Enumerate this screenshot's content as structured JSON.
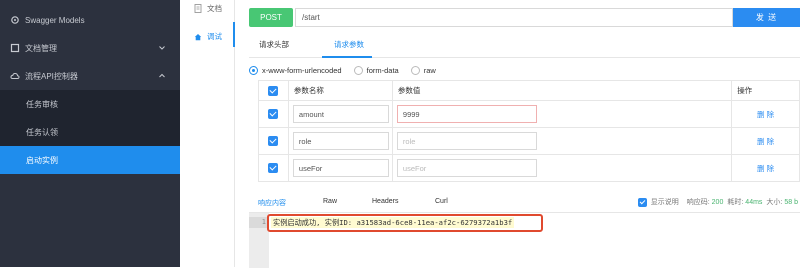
{
  "sidebar": {
    "items": [
      {
        "label": "Swagger Models",
        "icon": "settings-icon"
      },
      {
        "label": "文档管理",
        "icon": "gear-icon"
      },
      {
        "label": "流程API控制器",
        "icon": "cloud-icon"
      }
    ],
    "subitems": [
      {
        "label": "任务审核"
      },
      {
        "label": "任务认领"
      },
      {
        "label": "启动实例",
        "active": true
      }
    ]
  },
  "subnav": {
    "doc_label": "文档",
    "debug_label": "调试"
  },
  "request": {
    "method": "POST",
    "url": "/start",
    "send_label": "发 送"
  },
  "tabs": {
    "headers": "请求头部",
    "params": "请求参数"
  },
  "content_types": [
    "x-www-form-urlencoded",
    "form-data",
    "raw"
  ],
  "params_table": {
    "col_name": "参数名称",
    "col_value": "参数值",
    "col_action": "操作",
    "rows": [
      {
        "name": "amount",
        "value": "9999",
        "value_placeholder": "",
        "action": "删 除"
      },
      {
        "name": "role",
        "value": "",
        "value_placeholder": "role",
        "action": "删 除"
      },
      {
        "name": "useFor",
        "value": "",
        "value_placeholder": "useFor",
        "action": "删 除"
      }
    ]
  },
  "response": {
    "tabs": [
      "响应内容",
      "Raw",
      "Headers",
      "Curl"
    ],
    "show_desc_label": "显示说明",
    "status_label": "响应码:",
    "status_value": "200",
    "time_label": "耗时:",
    "time_value": "44ms",
    "size_label": "大小:",
    "size_value": "58 b",
    "line_number": "1",
    "body": "实例启动成功, 实例ID: a31583ad-6ce8-11ea-af2c-6279372a1b3f"
  },
  "colors": {
    "sidebar_bg": "#2c313e",
    "accent": "#1f8ded",
    "post_green": "#48c774",
    "highlight_red": "#e04a2f"
  }
}
